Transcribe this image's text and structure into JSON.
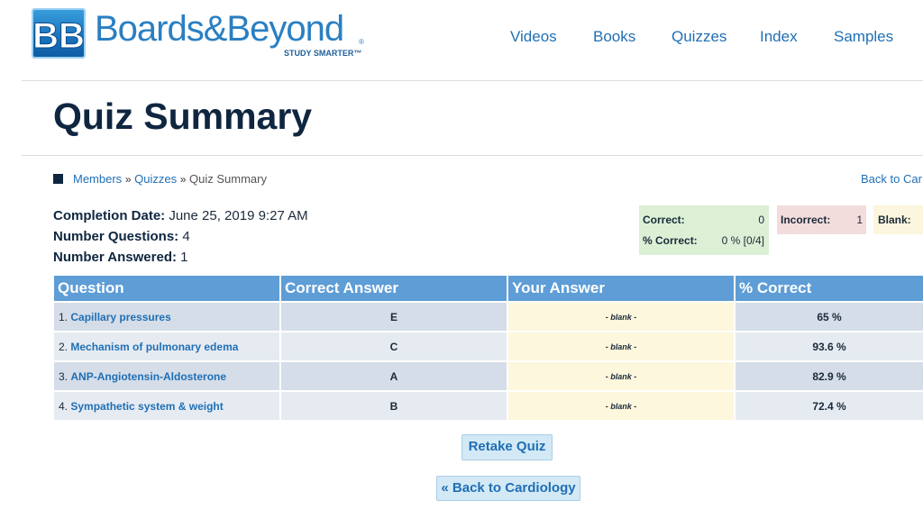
{
  "brand": {
    "name": "Boards&Beyond",
    "registered": "®",
    "tagline": "STUDY SMARTER™",
    "badge": "BB"
  },
  "nav": {
    "items": [
      "Videos",
      "Books",
      "Quizzes",
      "Index",
      "Samples"
    ]
  },
  "page": {
    "title": "Quiz Summary"
  },
  "breadcrumb": {
    "members": "Members",
    "quizzes": "Quizzes",
    "current": "Quiz Summary",
    "sep": "»",
    "back": "Back to Car"
  },
  "summary": {
    "completion_label": "Completion Date:",
    "completion_value": "June 25, 2019 9:27 AM",
    "questions_label": "Number Questions:",
    "questions_value": "4",
    "answered_label": "Number Answered:",
    "answered_value": "1"
  },
  "stats": {
    "correct_label": "Correct:",
    "correct_value": "0",
    "pct_label": "% Correct:",
    "pct_value": "0 % [0/4]",
    "incorrect_label": "Incorrect:",
    "incorrect_value": "1",
    "blank_label": "Blank:"
  },
  "table": {
    "headers": [
      "Question",
      "Correct Answer",
      "Your Answer",
      "% Correct"
    ],
    "rows": [
      {
        "num": "1.",
        "question": "Capillary pressures",
        "correct": "E",
        "yours": "- blank -",
        "pct": "65 %"
      },
      {
        "num": "2.",
        "question": "Mechanism of pulmonary edema",
        "correct": "C",
        "yours": "- blank -",
        "pct": "93.6 %"
      },
      {
        "num": "3.",
        "question": "ANP-Angiotensin-Aldosterone",
        "correct": "A",
        "yours": "- blank -",
        "pct": "82.9 %"
      },
      {
        "num": "4.",
        "question": "Sympathetic system & weight",
        "correct": "B",
        "yours": "- blank -",
        "pct": "72.4 %"
      }
    ]
  },
  "actions": {
    "retake": "Retake Quiz",
    "back": "« Back to Cardiology"
  }
}
